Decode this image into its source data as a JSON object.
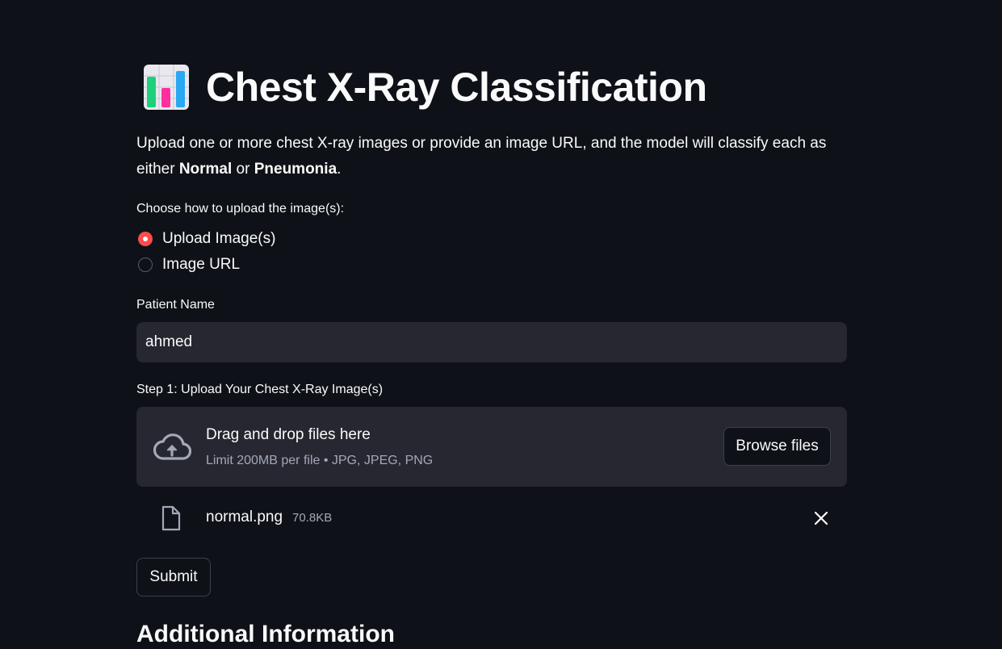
{
  "app": {
    "title": "Chest X-Ray Classification",
    "title_icon": "bar-chart-icon"
  },
  "intro": {
    "part1": "Upload one or more chest X-ray images or provide an image URL, and the model will classify each as either ",
    "bold1": "Normal",
    "mid": " or ",
    "bold2": "Pneumonia",
    "end": "."
  },
  "upload_mode": {
    "label": "Choose how to upload the image(s):",
    "options": [
      {
        "label": "Upload Image(s)",
        "selected": true
      },
      {
        "label": "Image URL",
        "selected": false
      }
    ]
  },
  "patient": {
    "label": "Patient Name",
    "value": "ahmed"
  },
  "uploader": {
    "label": "Step 1: Upload Your Chest X-Ray Image(s)",
    "drop_text": "Drag and drop files here",
    "limit_text": "Limit 200MB per file • JPG, JPEG, PNG",
    "browse_label": "Browse files",
    "icon": "cloud-upload-icon"
  },
  "files": [
    {
      "name": "normal.png",
      "size": "70.8KB",
      "icon": "file-icon"
    }
  ],
  "submit_label": "Submit",
  "next_section_heading": "Additional Information",
  "colors": {
    "background": "#0e1117",
    "input_bg": "#262730",
    "accent": "#ff4b4b",
    "text": "#fafafa",
    "muted": "#a3a8b8"
  }
}
